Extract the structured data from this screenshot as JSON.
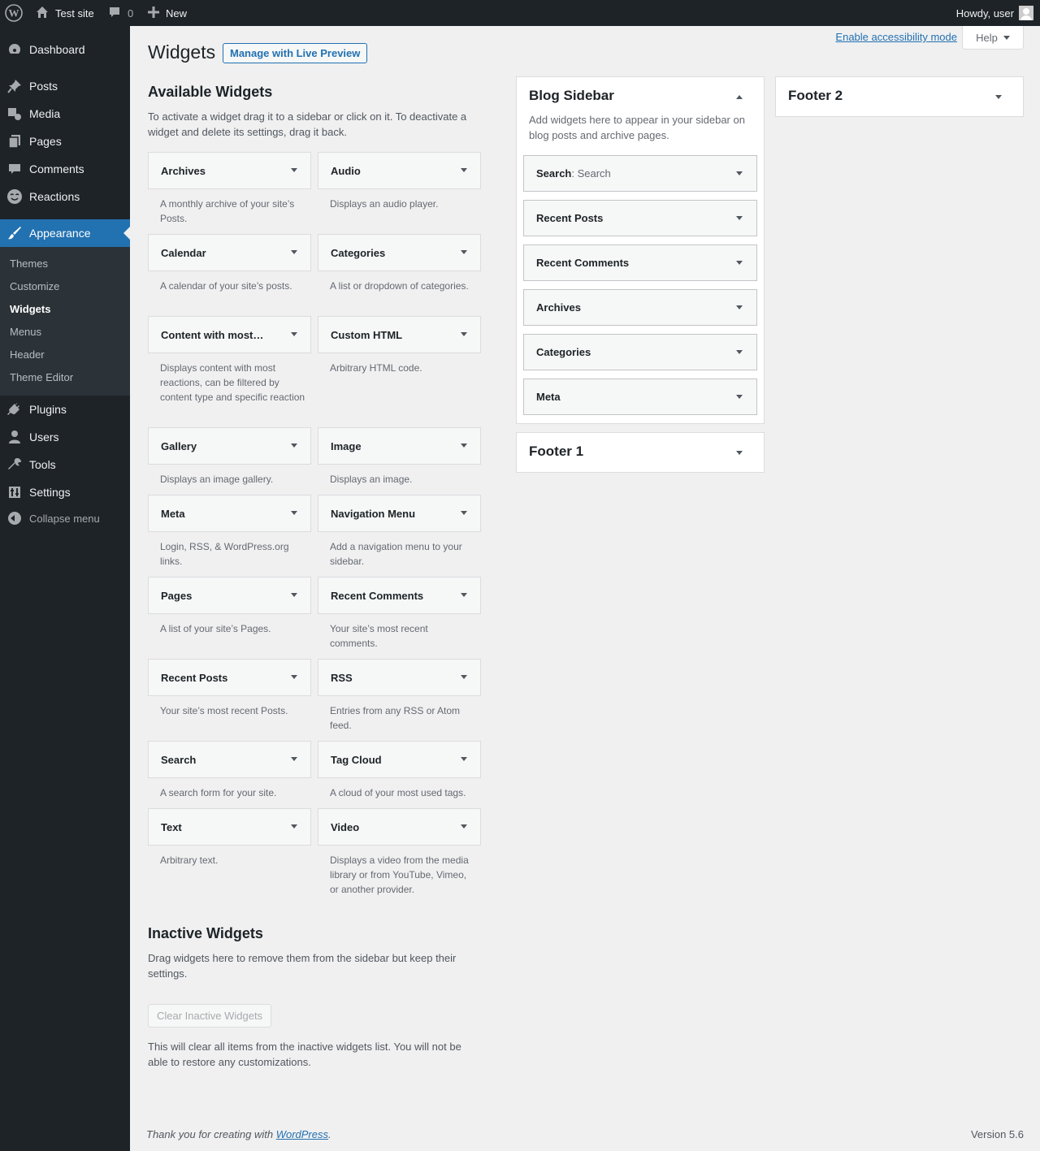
{
  "adminbar": {
    "site_name": "Test site",
    "comment_count": "0",
    "new_label": "New",
    "howdy": "Howdy, user"
  },
  "menu": {
    "dashboard": "Dashboard",
    "posts": "Posts",
    "media": "Media",
    "pages": "Pages",
    "comments": "Comments",
    "reactions": "Reactions",
    "appearance": "Appearance",
    "plugins": "Plugins",
    "users": "Users",
    "tools": "Tools",
    "settings": "Settings",
    "collapse": "Collapse menu",
    "submenu": {
      "themes": "Themes",
      "customize": "Customize",
      "widgets": "Widgets",
      "menus": "Menus",
      "header": "Header",
      "theme_editor": "Theme Editor"
    }
  },
  "header": {
    "title": "Widgets",
    "live_preview": "Manage with Live Preview",
    "accessibility": "Enable accessibility mode",
    "help": "Help"
  },
  "available": {
    "title": "Available Widgets",
    "description": "To activate a widget drag it to a sidebar or click on it. To deactivate a widget and delete its settings, drag it back.",
    "widgets": [
      {
        "name": "Archives",
        "desc": "A monthly archive of your site’s Posts."
      },
      {
        "name": "Audio",
        "desc": "Displays an audio player."
      },
      {
        "name": "Calendar",
        "desc": "A calendar of your site’s posts."
      },
      {
        "name": "Categories",
        "desc": "A list or dropdown of categories."
      },
      {
        "name": "Content with most…",
        "desc": "Displays content with most reactions, can be filtered by content type and specific reaction"
      },
      {
        "name": "Custom HTML",
        "desc": "Arbitrary HTML code."
      },
      {
        "name": "Gallery",
        "desc": "Displays an image gallery."
      },
      {
        "name": "Image",
        "desc": "Displays an image."
      },
      {
        "name": "Meta",
        "desc": "Login, RSS, & WordPress.org links."
      },
      {
        "name": "Navigation Menu",
        "desc": "Add a navigation menu to your sidebar."
      },
      {
        "name": "Pages",
        "desc": "A list of your site’s Pages."
      },
      {
        "name": "Recent Comments",
        "desc": "Your site’s most recent comments."
      },
      {
        "name": "Recent Posts",
        "desc": "Your site’s most recent Posts."
      },
      {
        "name": "RSS",
        "desc": "Entries from any RSS or Atom feed."
      },
      {
        "name": "Search",
        "desc": "A search form for your site."
      },
      {
        "name": "Tag Cloud",
        "desc": "A cloud of your most used tags."
      },
      {
        "name": "Text",
        "desc": "Arbitrary text."
      },
      {
        "name": "Video",
        "desc": "Displays a video from the media library or from YouTube, Vimeo, or another provider."
      }
    ]
  },
  "inactive": {
    "title": "Inactive Widgets",
    "description": "Drag widgets here to remove them from the sidebar but keep their settings.",
    "clear_button": "Clear Inactive Widgets",
    "clear_note": "This will clear all items from the inactive widgets list. You will not be able to restore any customizations."
  },
  "blog_sidebar": {
    "title": "Blog Sidebar",
    "description": "Add widgets here to appear in your sidebar on blog posts and archive pages.",
    "widgets": [
      {
        "name": "Search",
        "in_title": ": Search"
      },
      {
        "name": "Recent Posts",
        "in_title": ""
      },
      {
        "name": "Recent Comments",
        "in_title": ""
      },
      {
        "name": "Archives",
        "in_title": ""
      },
      {
        "name": "Categories",
        "in_title": ""
      },
      {
        "name": "Meta",
        "in_title": ""
      }
    ]
  },
  "footer1": {
    "title": "Footer 1"
  },
  "footer2": {
    "title": "Footer 2"
  },
  "footer": {
    "thanks_prefix": "Thank you for creating with ",
    "wp_link": "WordPress",
    "thanks_suffix": ".",
    "version": "Version 5.6"
  }
}
